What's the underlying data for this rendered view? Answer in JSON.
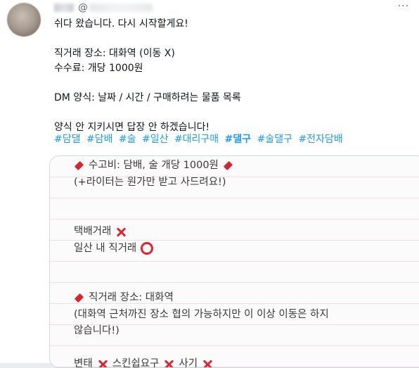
{
  "header": {
    "at_symbol": "@"
  },
  "tweet": {
    "lines": [
      "쉬다 왔습니다. 다시 시작할게요!",
      "직거래 장소: 대화역 (이동 X)",
      "수수료: 개당 1000원",
      "DM 양식: 날짜 / 시간 / 구매하려는 물품 목록",
      "양식 안 지키시면 답장 안 하겠습니다!"
    ],
    "hashtags": [
      "#담댈",
      "#담배",
      "#술",
      "#일산",
      "#대리구매",
      "#댈구",
      "#술댈구",
      "#전자담배"
    ]
  },
  "image": {
    "fee_line": "수고비: 담배, 술 개당 1000원",
    "lighter_line": "(+라이터는 원가만 받고 사드려요!)",
    "delivery_line": "택배거래",
    "local_line": "일산 내 직거래",
    "place_line": "직거래 장소: 대화역",
    "place_note_1": "(대화역 근처까진 장소 협의 가능하지만 이 이상 이동은 하지",
    "place_note_2": "않습니다!)",
    "rule_1": "변태",
    "rule_2": "스킨쉽요구",
    "rule_3": "사기"
  },
  "colors": {
    "accent": "#1d9bf0",
    "mark_red": "#e0242f",
    "diamond_red": "#d9232e"
  }
}
